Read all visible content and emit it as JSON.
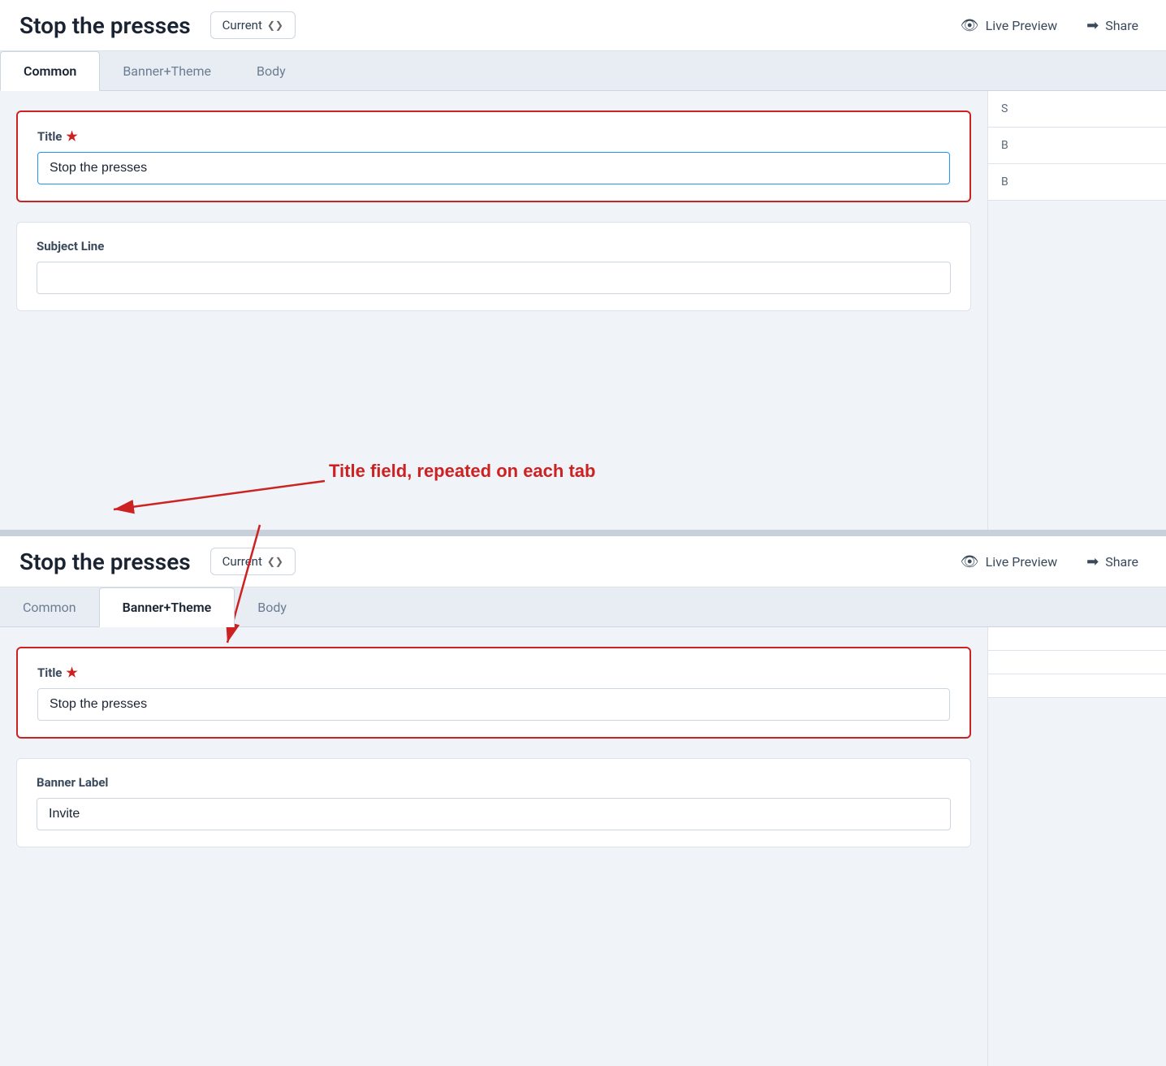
{
  "panels": [
    {
      "id": "top",
      "header": {
        "title": "Stop the presses",
        "version_dropdown": "Current",
        "live_preview_label": "Live Preview",
        "share_label": "Share"
      },
      "tabs": [
        {
          "id": "common",
          "label": "Common",
          "active": true
        },
        {
          "id": "banner_theme",
          "label": "Banner+Theme",
          "active": false
        },
        {
          "id": "body",
          "label": "Body",
          "active": false
        }
      ],
      "fields": [
        {
          "id": "title",
          "label": "Title",
          "required": true,
          "value": "Stop the presses",
          "highlighted": true,
          "focused": true
        },
        {
          "id": "subject_line",
          "label": "Subject Line",
          "required": false,
          "value": "",
          "highlighted": false,
          "focused": false
        }
      ]
    },
    {
      "id": "bottom",
      "header": {
        "title": "Stop the presses",
        "version_dropdown": "Current",
        "live_preview_label": "Live Preview",
        "share_label": "Share"
      },
      "tabs": [
        {
          "id": "common",
          "label": "Common",
          "active": false
        },
        {
          "id": "banner_theme",
          "label": "Banner+Theme",
          "active": true
        },
        {
          "id": "body",
          "label": "Body",
          "active": false
        }
      ],
      "fields": [
        {
          "id": "title",
          "label": "Title",
          "required": true,
          "value": "Stop the presses",
          "highlighted": true,
          "focused": false
        },
        {
          "id": "banner_label",
          "label": "Banner Label",
          "required": false,
          "value": "Invite",
          "highlighted": false,
          "focused": false
        }
      ]
    }
  ],
  "annotation": {
    "text": "Title field, repeated on each tab"
  },
  "right_panel_items": [
    {
      "label": "S"
    },
    {
      "label": "B"
    },
    {
      "label": "B"
    }
  ]
}
